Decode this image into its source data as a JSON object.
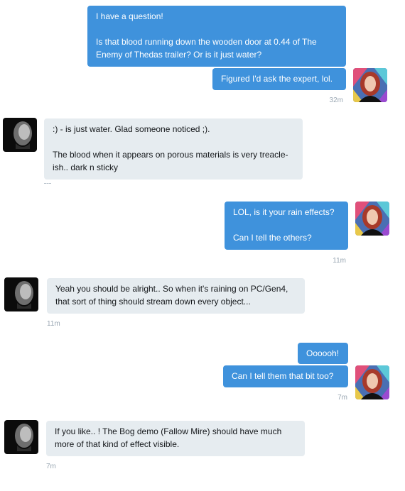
{
  "messages": [
    {
      "from": "me",
      "paragraphs": [
        "I have a question!",
        "Is that blood running down the wooden door at 0.44 of The Enemy of Thedas trailer? Or is it just water?"
      ]
    },
    {
      "from": "me",
      "paragraphs": [
        "Figured I'd ask the expert, lol."
      ],
      "time": "32m"
    },
    {
      "from": "them",
      "paragraphs": [
        ":) - is just water. Glad someone noticed ;).",
        "The blood when it appears on porous materials is very treacle-ish.. dark n sticky"
      ]
    },
    {
      "from": "me",
      "paragraphs": [
        "LOL, is it your rain effects?",
        "Can I tell the others?"
      ],
      "time": "11m"
    },
    {
      "from": "them",
      "paragraphs": [
        "Yeah you should be alright.. So when it's raining on PC/Gen4, that sort of thing should stream down every object..."
      ],
      "time": "11m"
    },
    {
      "from": "me",
      "paragraphs": [
        "Oooooh!"
      ]
    },
    {
      "from": "me",
      "paragraphs": [
        "Can I tell them that bit too?"
      ],
      "time": "7m"
    },
    {
      "from": "them",
      "paragraphs": [
        "If you like.. ! The Bog demo (Fallow Mire) should have much more of that kind of effect visible."
      ],
      "time": "7m"
    }
  ],
  "colors": {
    "outgoing_bubble": "#3f92dc",
    "incoming_bubble": "#e6ecf0",
    "timestamp": "#9aa7b3"
  },
  "avatars": {
    "me": "red-haired-woman-avatar",
    "them": "bald-man-avatar"
  }
}
